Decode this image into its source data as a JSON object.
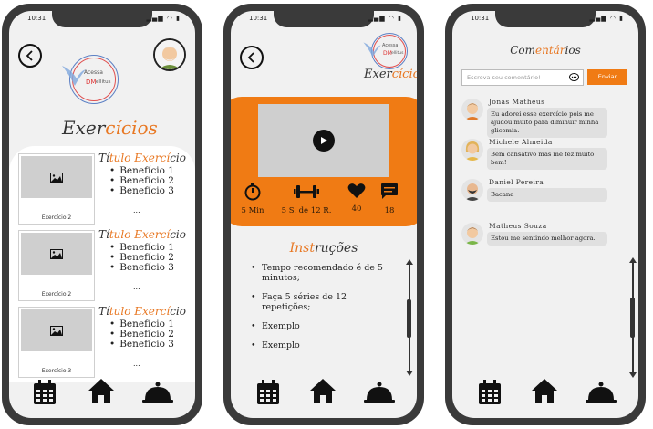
{
  "status": {
    "time": "10:31",
    "icons": "▂▄▆ ◠ ▮"
  },
  "logo": {
    "top": "Acessa",
    "dm": "DM",
    "tail": "ellitus"
  },
  "screen1": {
    "title_a": "Exer",
    "title_b": "cícios",
    "exercises": [
      {
        "title_a": "Tí",
        "title_b": "tulo Exercí",
        "title_c": "cio",
        "caption": "Exercício 2",
        "benefits": [
          "Benefício 1",
          "Benefício 2",
          "Benefício 3"
        ],
        "more": "..."
      },
      {
        "title_a": "Tí",
        "title_b": "tulo Exercí",
        "title_c": "cio",
        "caption": "Exercício 2",
        "benefits": [
          "Benefício 1",
          "Benefício 2",
          "Benefício 3"
        ],
        "more": "..."
      },
      {
        "title_a": "Tí",
        "title_b": "tulo Exercí",
        "title_c": "cio",
        "caption": "Exercício 3",
        "benefits": [
          "Benefício 1",
          "Benefício 2",
          "Benefício 3"
        ],
        "more": "..."
      }
    ]
  },
  "screen2": {
    "title_a": "Exer",
    "title_b": "cícios",
    "stats": {
      "time": "5 Min",
      "series": "5 S. de 12 R.",
      "likes": "40",
      "comments": "18"
    },
    "instructions_title_a": "Inst",
    "instructions_title_b": "ruções",
    "instructions": [
      "Tempo recomendado é de 5 minutos;",
      "Faça 5 séries de 12 repetições;",
      "Exemplo",
      "Exemplo"
    ]
  },
  "screen3": {
    "title_a": "Com",
    "title_b": "entár",
    "title_c": "ios",
    "input_placeholder": "Escreva seu comentário!",
    "send_label": "Enviar",
    "comments": [
      {
        "name": "Jonas Matheus",
        "text": "Eu adorei esse exercício pois me ajudou muito para diminuir minha glicemia."
      },
      {
        "name": "Michele Almeida",
        "text": "Bem cansativo mas me fez muito bem!"
      },
      {
        "name": "Daniel Pereira",
        "text": "Bacana"
      },
      {
        "name": "Matheus Souza",
        "text": "Estou me sentindo melhor agora."
      }
    ]
  },
  "colors": {
    "accent": "#f07b14",
    "frame": "#3a3a3a",
    "screen": "#f1f1f1"
  }
}
